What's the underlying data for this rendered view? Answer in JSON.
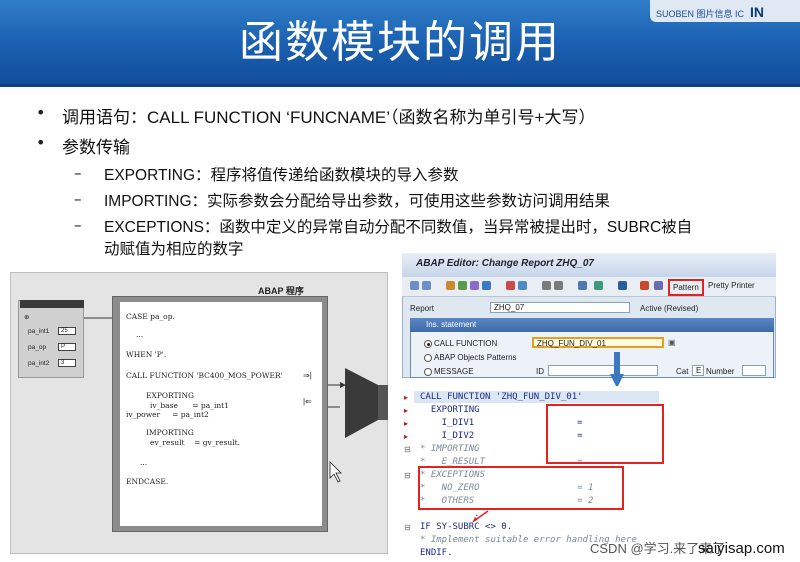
{
  "header": {
    "title": "函数模块的调用",
    "logo_text": "SUOBEN 图片信息 IC",
    "logo_suffix": "IN"
  },
  "bullets": [
    {
      "text": "调用语句：CALL FUNCTION ‘FUNCNAME’（函数名称为单引号+大写）"
    },
    {
      "text": "参数传输"
    }
  ],
  "sub_bullets": [
    {
      "text": "EXPORTING：程序将值传递给函数模块的导入参数"
    },
    {
      "text": "IMPORTING：实际参数会分配给导出参数，可使用这些参数访问调用结果"
    },
    {
      "text": "EXCEPTIONS：函数中定义的异常自动分配不同数值，当异常被提出时，SUBRC被自"
    },
    {
      "text": "动赋值为相应的数字"
    }
  ],
  "diagram": {
    "title": "ABAP 程序",
    "side_fields": [
      {
        "label": "pa_int1",
        "value": "25"
      },
      {
        "label": "pa_op",
        "value": "P"
      },
      {
        "label": "pa_int2",
        "value": "3"
      }
    ],
    "code": [
      "CASE pa_op.",
      "...",
      "WHEN 'P'.",
      "CALL FUNCTION 'BC400_MOS_POWER'",
      "EXPORTING",
      "iv_base      = pa_int1",
      "iv_power     = pa_int2",
      "IMPORTING",
      "ev_result    = gv_result.",
      "...",
      "ENDCASE."
    ]
  },
  "sap_editor": {
    "title": "ABAP Editor: Change Report ZHQ_07",
    "pattern_button": "Pattern",
    "pretty_printer_button": "Pretty Printer",
    "report_label": "Report",
    "report_value": "ZHQ_07",
    "status_text": "Active (Revised)",
    "dialog_title": "Ins. statement",
    "options": [
      {
        "label": "CALL FUNCTION",
        "selected": true,
        "value": "ZHQ_FUN_DIV_01"
      },
      {
        "label": "ABAP Objects Patterns",
        "selected": false,
        "value": ""
      },
      {
        "label": "MESSAGE",
        "selected": false,
        "value": ""
      }
    ],
    "id_label": "ID",
    "cat_label": "Cat",
    "cat_value": "E",
    "number_label": "Number"
  },
  "code_view": {
    "lines": [
      "CALL FUNCTION 'ZHQ_FUN_DIV_01'",
      "  EXPORTING",
      "    I_DIV1                   =",
      "    I_DIV2                   =",
      "* IMPORTING",
      "*   E_RESULT                 =",
      "* EXCEPTIONS",
      "*   NO_ZERO                  = 1",
      "*   OTHERS                   = 2",
      "          .",
      "IF SY-SUBRC <> 0.",
      "* Implement suitable error handling here",
      "ENDIF."
    ]
  },
  "watermark": {
    "text": "CSDN @学习.来了来了",
    "site": "saiyisap.com"
  },
  "colors": {
    "header_blue": "#1a5fb0",
    "highlight_red": "#e32222",
    "code_blue": "#1c2a8c",
    "arrow_blue": "#3a78c4"
  }
}
